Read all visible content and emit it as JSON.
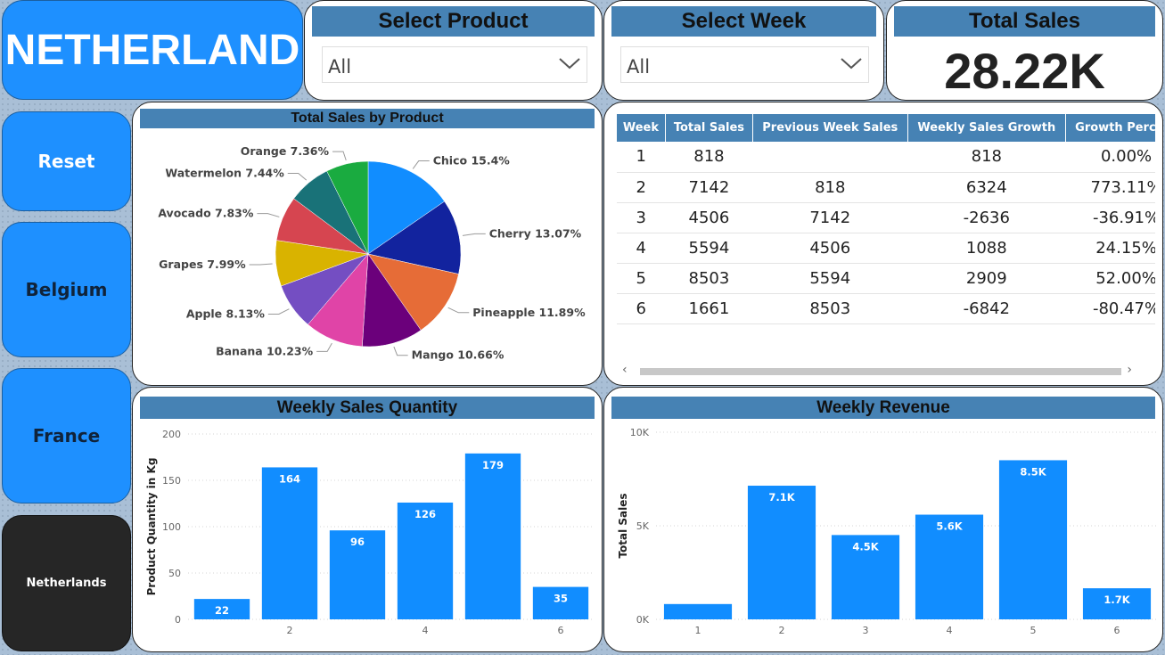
{
  "title": "NETHERLAND",
  "nav": {
    "reset": "Reset",
    "belgium": "Belgium",
    "france": "France",
    "netherlands": "Netherlands"
  },
  "filters": {
    "product_label": "Select Product",
    "product_value": "All",
    "week_label": "Select Week",
    "week_value": "All"
  },
  "kpi": {
    "label": "Total Sales",
    "value": "28.22K"
  },
  "pie": {
    "title": "Total Sales by Product",
    "slices": [
      {
        "name": "Chico",
        "pct": 15.4,
        "label": "Chico 15.4%",
        "color": "#118dff"
      },
      {
        "name": "Cherry",
        "pct": 13.07,
        "label": "Cherry 13.07%",
        "color": "#12239e"
      },
      {
        "name": "Pineapple",
        "pct": 11.89,
        "label": "Pineapple 11.89%",
        "color": "#e66c37"
      },
      {
        "name": "Mango",
        "pct": 10.66,
        "label": "Mango 10.66%",
        "color": "#6b007b"
      },
      {
        "name": "Banana",
        "pct": 10.23,
        "label": "Banana 10.23%",
        "color": "#e044a7"
      },
      {
        "name": "Apple",
        "pct": 8.13,
        "label": "Apple 8.13%",
        "color": "#744ec2"
      },
      {
        "name": "Grapes",
        "pct": 7.99,
        "label": "Grapes 7.99%",
        "color": "#d9b300"
      },
      {
        "name": "Avocado",
        "pct": 7.83,
        "label": "Avocado 7.83%",
        "color": "#d64550"
      },
      {
        "name": "Watermelon",
        "pct": 7.44,
        "label": "Watermelon 7.44%",
        "color": "#197278"
      },
      {
        "name": "Orange",
        "pct": 7.36,
        "label": "Orange 7.36%",
        "color": "#1aab40"
      }
    ]
  },
  "table": {
    "headers": [
      "Week",
      "Total Sales",
      "Previous Week Sales",
      "Weekly Sales Growth",
      "Growth Percent"
    ],
    "rows": [
      [
        "1",
        "818",
        "",
        "818",
        "0.00%"
      ],
      [
        "2",
        "7142",
        "818",
        "6324",
        "773.11%"
      ],
      [
        "3",
        "4506",
        "7142",
        "-2636",
        "-36.91%"
      ],
      [
        "4",
        "5594",
        "4506",
        "1088",
        "24.15%"
      ],
      [
        "5",
        "8503",
        "5594",
        "2909",
        "52.00%"
      ],
      [
        "6",
        "1661",
        "8503",
        "-6842",
        "-80.47%"
      ]
    ],
    "scroll_left": "‹",
    "scroll_right": "›"
  },
  "chart_data": [
    {
      "type": "bar",
      "title": "Weekly Sales Quantity",
      "ylabel": "Product Quantity in Kg",
      "xlabel": "",
      "categories": [
        1,
        2,
        3,
        4,
        5,
        6
      ],
      "values": [
        22,
        164,
        96,
        126,
        179,
        35
      ],
      "data_labels": [
        "22",
        "164",
        "96",
        "126",
        "179",
        "35"
      ],
      "ylim": [
        0,
        200
      ],
      "yticks": [
        0,
        50,
        100,
        150,
        200
      ],
      "ytick_labels": [
        "0",
        "50",
        "100",
        "150",
        "200"
      ],
      "xtick_labels": [
        "2",
        "4",
        "6"
      ],
      "xtick_values": [
        2,
        4,
        6
      ],
      "color": "#118dff",
      "grid": true
    },
    {
      "type": "bar",
      "title": "Weekly Revenue",
      "ylabel": "Total Sales",
      "xlabel": "",
      "categories": [
        1,
        2,
        3,
        4,
        5,
        6
      ],
      "values": [
        818,
        7142,
        4506,
        5594,
        8503,
        1661
      ],
      "data_labels": [
        "",
        "7.1K",
        "4.5K",
        "5.6K",
        "8.5K",
        "1.7K"
      ],
      "ylim": [
        0,
        10000
      ],
      "yticks": [
        0,
        5000,
        10000
      ],
      "ytick_labels": [
        "0K",
        "5K",
        "10K"
      ],
      "xtick_labels": [
        "1",
        "2",
        "3",
        "4",
        "5",
        "6"
      ],
      "xtick_values": [
        1,
        2,
        3,
        4,
        5,
        6
      ],
      "color": "#118dff",
      "grid": true
    }
  ]
}
